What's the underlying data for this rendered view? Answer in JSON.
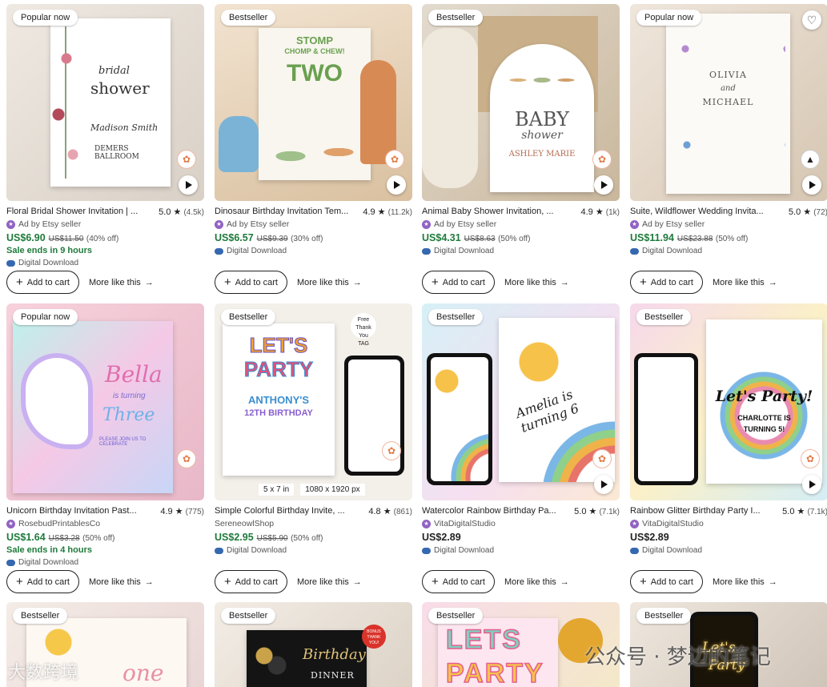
{
  "colors": {
    "price_green": "#1e7a3b",
    "ad_icon": "#9163c4",
    "cloud_icon": "#3568b0"
  },
  "common": {
    "add_to_cart": "Add to cart",
    "more_like_this": "More like this",
    "digital_download": "Digital Download",
    "play_icon": "play-icon",
    "star_icon": "star-icon"
  },
  "products": [
    {
      "badge": "Popular now",
      "title": "Floral Bridal Shower Invitation | ...",
      "rating": "5.0 ★",
      "count": "(4.5k)",
      "seller": "Ad by Etsy seller",
      "price": "US$6.90",
      "orig": "US$11.50",
      "off": "(40% off)",
      "sale": "Sale ends in 9 hours",
      "img_lines": [
        "bridal",
        "shower",
        "Madison Smith",
        "DEMERS BALLROOM"
      ]
    },
    {
      "badge": "Bestseller",
      "title": "Dinosaur Birthday Invitation Tem...",
      "rating": "4.9 ★",
      "count": "(11.2k)",
      "seller": "Ad by Etsy seller",
      "price": "US$6.57",
      "orig": "US$9.39",
      "off": "(30% off)",
      "sale": "",
      "img_lines": [
        "STOMP",
        "CHOMP & CHEW!",
        "TWO"
      ]
    },
    {
      "badge": "Bestseller",
      "title": "Animal Baby Shower Invitation, ...",
      "rating": "4.9 ★",
      "count": "(1k)",
      "seller": "Ad by Etsy seller",
      "price": "US$4.31",
      "orig": "US$8.63",
      "off": "(50% off)",
      "sale": "",
      "img_lines": [
        "BABY",
        "shower",
        "ASHLEY MARIE"
      ]
    },
    {
      "badge": "Popular now",
      "title": "Suite, Wildflower Wedding Invita...",
      "rating": "5.0 ★",
      "count": "(72)",
      "seller": "Ad by Etsy seller",
      "price": "US$11.94",
      "orig": "US$23.88",
      "off": "(50% off)",
      "sale": "",
      "img_lines": [
        "OLIVIA",
        "and",
        "MICHAEL"
      ]
    },
    {
      "badge": "Popular now",
      "title": "Unicorn Birthday Invitation Past...",
      "rating": "4.9 ★",
      "count": "(775)",
      "seller": "RosebudPrintablesCo",
      "price": "US$1.64",
      "orig": "US$3.28",
      "off": "(50% off)",
      "sale": "Sale ends in 4 hours",
      "img_lines": [
        "Bella",
        "is turning",
        "Three",
        "PLEASE JOIN US TO CELEBRATE"
      ]
    },
    {
      "badge": "Bestseller",
      "title": "Simple Colorful Birthday Invite, ...",
      "rating": "4.8 ★",
      "count": "(861)",
      "seller": "SereneowlShop",
      "price": "US$2.95",
      "orig": "US$5.90",
      "off": "(50% off)",
      "sale": "",
      "img_lines": [
        "LET'S",
        "PARTY",
        "ANTHONY'S",
        "12TH BIRTHDAY",
        "5 x 7 in",
        "1080 x 1920 px"
      ]
    },
    {
      "badge": "Bestseller",
      "title": "Watercolor Rainbow Birthday Pa...",
      "rating": "5.0 ★",
      "count": "(7.1k)",
      "seller": "VitaDigitalStudio",
      "price": "US$2.89",
      "orig": "",
      "off": "",
      "sale": "",
      "img_lines": [
        "Amelia is turning 6"
      ]
    },
    {
      "badge": "Bestseller",
      "title": "Rainbow Glitter Birthday Party I...",
      "rating": "5.0 ★",
      "count": "(7.1k)",
      "seller": "VitaDigitalStudio",
      "price": "US$2.89",
      "orig": "",
      "off": "",
      "sale": "",
      "img_lines": [
        "Let's Party!",
        "CHARLOTTE IS",
        "TURNING 5!"
      ]
    },
    {
      "badge": "Bestseller",
      "img_lines": [
        "one"
      ]
    },
    {
      "badge": "Bestseller",
      "img_lines": [
        "Birthday",
        "DINNER"
      ]
    },
    {
      "badge": "Bestseller",
      "img_lines": [
        "LETS",
        "PARTY"
      ]
    },
    {
      "badge": "Bestseller",
      "img_lines": [
        "Let's",
        "Party"
      ]
    }
  ],
  "watermarks": {
    "left": "大数跨境",
    "right": "公众号 · 梦边的笔记"
  }
}
